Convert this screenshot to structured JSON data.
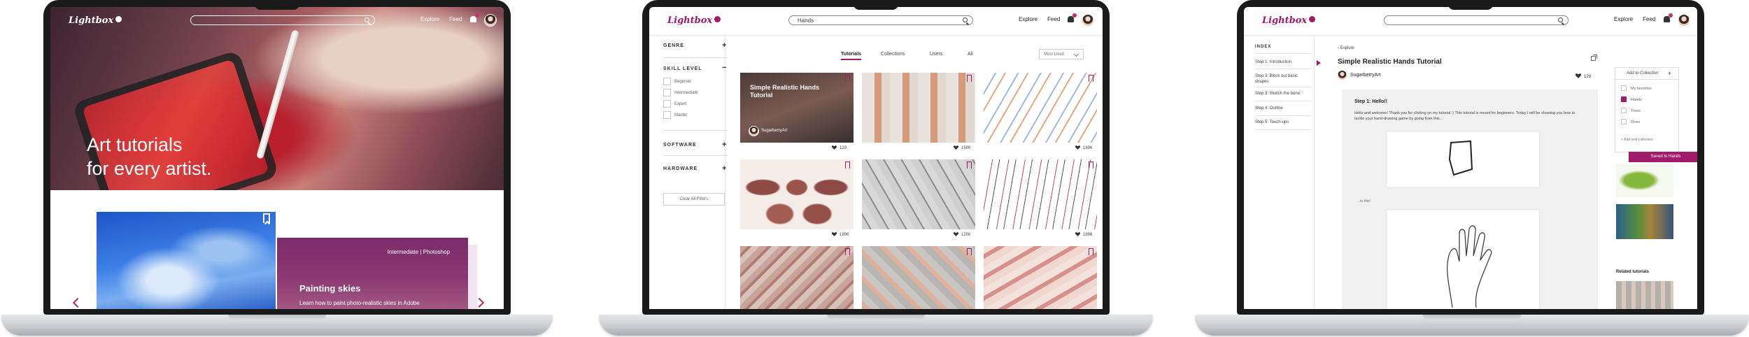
{
  "brand": {
    "name": "Lightbox",
    "accent": "#a21a6a"
  },
  "screen1": {
    "nav": {
      "explore": "Explore",
      "feed": "Feed"
    },
    "hero_title_1": "Art tutorials",
    "hero_title_2": "for every artist.",
    "card": {
      "meta": "Intermediate | Photoshop",
      "title": "Painting skies",
      "desc": "Learn how to paint photo-realistic skies in Adobe"
    }
  },
  "screen2": {
    "search_value": "Hands",
    "nav": {
      "explore": "Explore",
      "feed": "Feed"
    },
    "filters": {
      "genre": "GENRE",
      "skill": "SKILL LEVEL",
      "skill_options": [
        "Beginner",
        "Intermediate",
        "Expert",
        "Master"
      ],
      "software": "SOFTWARE",
      "hardware": "HARDWARE",
      "clear": "Clear All Filters"
    },
    "tabs": [
      "Tutorials",
      "Collections",
      "Users",
      "All"
    ],
    "sort": "Most Liked",
    "featured": {
      "title": "Simple Realistic Hands Tutorial",
      "author": "SugarberryArt"
    },
    "likes": [
      "129",
      "1500",
      "1896",
      "1896",
      "1200",
      "1896"
    ]
  },
  "screen3": {
    "nav": {
      "explore": "Explore",
      "feed": "Feed"
    },
    "index_label": "INDEX",
    "steps": [
      "Step 1: Introduction",
      "Step 2: Block out basic shapes",
      "Step 3: Sketch the bone",
      "Step 4: Outline",
      "Step 5: Touch-ups"
    ],
    "breadcrumb": "Explore",
    "title": "Simple Realistic Hands Tutorial",
    "author": "SugarberryArt",
    "likes": "129",
    "step_title": "Step 1: Hello!!",
    "body": "Hello and welcome! Thank you for clicking on my tutorial :) This tutorial is meant for beginners. Today I will be showing you how to tackle your hand-drawing game by going from this...",
    "caption": "...to this!",
    "collections": {
      "header": "Add to Collection",
      "options": [
        "My favorites",
        "Hands",
        "Trees",
        "Ones"
      ],
      "add_new": "Add new collection",
      "saved": "Saved to Hands"
    },
    "related": "Related tutorials"
  }
}
